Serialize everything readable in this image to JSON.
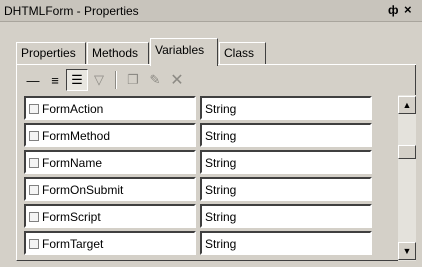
{
  "window": {
    "title": "DHTMLForm - Properties",
    "pin_glyph": "ф",
    "close_glyph": "×"
  },
  "tabs": [
    {
      "label": "Properties",
      "active": false
    },
    {
      "label": "Methods",
      "active": false
    },
    {
      "label": "Variables",
      "active": true
    },
    {
      "label": "Class",
      "active": false
    }
  ],
  "toolbar": {
    "buttons": [
      {
        "icon": "view-flat-icon",
        "glyph": "—",
        "state": "normal"
      },
      {
        "icon": "view-grouped-icon",
        "glyph": "≡",
        "state": "normal"
      },
      {
        "icon": "view-detailed-icon",
        "glyph": "☰",
        "state": "pressed"
      },
      {
        "icon": "filter-icon",
        "glyph": "▽",
        "state": "disabled"
      },
      {
        "icon": "new-item-icon",
        "glyph": "❐",
        "state": "disabled"
      },
      {
        "icon": "edit-icon",
        "glyph": "✎",
        "state": "disabled"
      },
      {
        "icon": "delete-icon",
        "glyph": "✕",
        "state": "disabled"
      }
    ]
  },
  "variables": [
    {
      "name": "FormAction",
      "type": "String"
    },
    {
      "name": "FormMethod",
      "type": "String"
    },
    {
      "name": "FormName",
      "type": "String"
    },
    {
      "name": "FormOnSubmit",
      "type": "String"
    },
    {
      "name": "FormScript",
      "type": "String"
    },
    {
      "name": "FormTarget",
      "type": "String"
    }
  ],
  "scrollbar": {
    "up_glyph": "▲",
    "down_glyph": "▼"
  },
  "colors": {
    "face": "#d4d0c8",
    "title_bg": "#c8c4bc",
    "cell_bg": "#ffffff",
    "disabled": "#8c8a84"
  }
}
